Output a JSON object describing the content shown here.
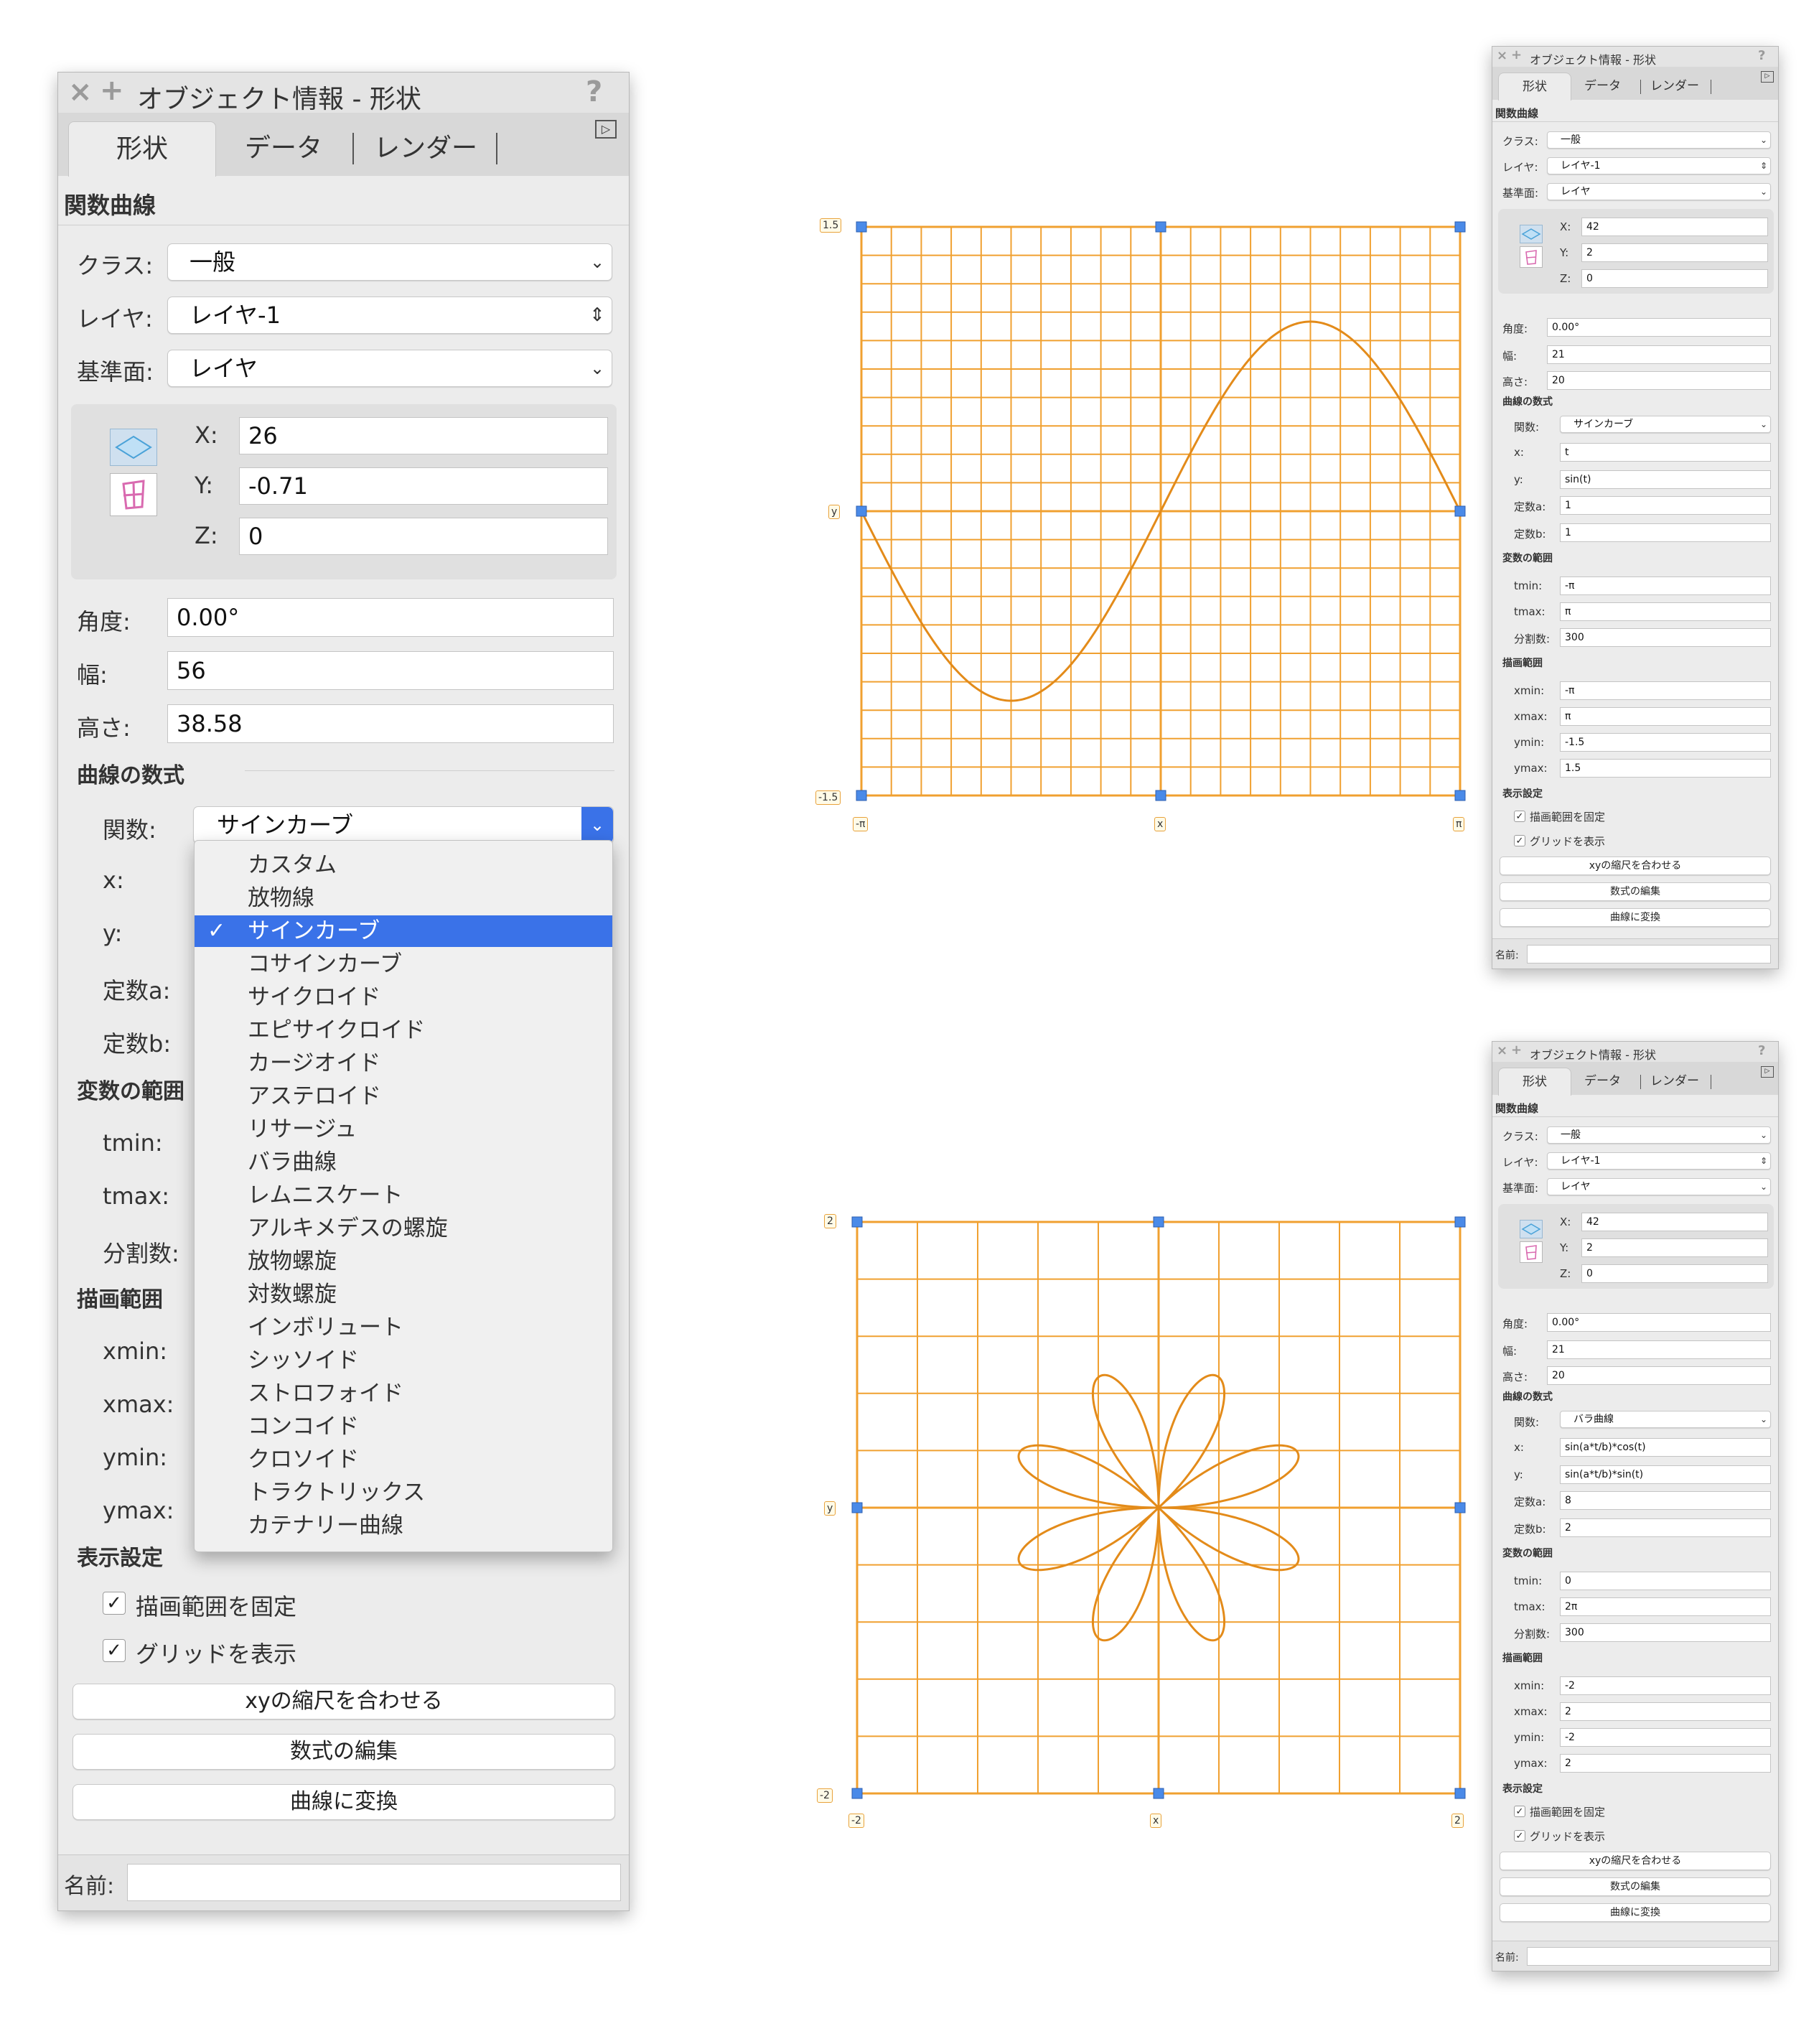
{
  "colors": {
    "grid": "#F0A030",
    "grid_major": "#E08A18",
    "curve": "#E38B1A",
    "handle": "#4A8AE8",
    "selected": "#3A72E8"
  },
  "big_palette": {
    "title": "オブジェクト情報 - 形状",
    "close_icon": "×",
    "add_icon": "+",
    "help_icon": "?",
    "tabs": [
      "形状",
      "データ",
      "レンダー"
    ],
    "section": "関数曲線",
    "class_label": "クラス:",
    "class_value": "一般",
    "layer_label": "レイヤ:",
    "layer_value": "レイヤ-1",
    "plane_label": "基準面:",
    "plane_value": "レイヤ",
    "x_label": "X:",
    "x_value": "26",
    "y_label": "Y:",
    "y_value": "-0.71",
    "z_label": "Z:",
    "z_value": "0",
    "angle_label": "角度:",
    "angle_value": "0.00°",
    "width_label": "幅:",
    "width_value": "56",
    "height_label": "高さ:",
    "height_value": "38.58",
    "formula_section": "曲線の数式",
    "func_label": "関数:",
    "func_value": "サインカーブ",
    "fx_label": "x:",
    "fy_label": "y:",
    "a_label": "定数a:",
    "b_label": "定数b:",
    "var_section": "変数の範囲",
    "tmin_label": "tmin:",
    "tmax_label": "tmax:",
    "div_label": "分割数:",
    "draw_section": "描画範囲",
    "xmin_label": "xmin:",
    "xmax_label": "xmax:",
    "ymin_label": "ymin:",
    "ymax_label": "ymax:",
    "display_section": "表示設定",
    "fix_range": "描画範囲を固定",
    "show_grid": "グリッドを表示",
    "btn_scale": "xyの縮尺を合わせる",
    "btn_edit": "数式の編集",
    "btn_convert": "曲線に変換",
    "name_label": "名前:"
  },
  "dropdown": {
    "items": [
      "カスタム",
      "放物線",
      "サインカーブ",
      "コサインカーブ",
      "サイクロイド",
      "エピサイクロイド",
      "カージオイド",
      "アステロイド",
      "リサージュ",
      "バラ曲線",
      "レムニスケート",
      "アルキメデスの螺旋",
      "放物螺旋",
      "対数螺旋",
      "インボリュート",
      "シッソイド",
      "ストロフォイド",
      "コンコイド",
      "クロソイド",
      "トラクトリックス",
      "カテナリー曲線"
    ],
    "selected_index": 2,
    "check": "✓"
  },
  "palette_top": {
    "title": "オブジェクト情報 - 形状",
    "tabs": [
      "形状",
      "データ",
      "レンダー"
    ],
    "section": "関数曲線",
    "class_label": "クラス:",
    "class_value": "一般",
    "layer_label": "レイヤ:",
    "layer_value": "レイヤ-1",
    "plane_label": "基準面:",
    "plane_value": "レイヤ",
    "x_label": "X:",
    "x_value": "42",
    "y_label": "Y:",
    "y_value": "2",
    "z_label": "Z:",
    "z_value": "0",
    "angle_label": "角度:",
    "angle_value": "0.00°",
    "width_label": "幅:",
    "width_value": "21",
    "height_label": "高さ:",
    "height_value": "20",
    "formula_section": "曲線の数式",
    "func_label": "関数:",
    "func_value": "サインカーブ",
    "fx_label": "x:",
    "fx_value": "t",
    "fy_label": "y:",
    "fy_value": "sin(t)",
    "a_label": "定数a:",
    "a_value": "1",
    "b_label": "定数b:",
    "b_value": "1",
    "var_section": "変数の範囲",
    "tmin_label": "tmin:",
    "tmin_value": "-π",
    "tmax_label": "tmax:",
    "tmax_value": "π",
    "div_label": "分割数:",
    "div_value": "300",
    "draw_section": "描画範囲",
    "xmin_label": "xmin:",
    "xmin_value": "-π",
    "xmax_label": "xmax:",
    "xmax_value": "π",
    "ymin_label": "ymin:",
    "ymin_value": "-1.5",
    "ymax_label": "ymax:",
    "ymax_value": "1.5",
    "display_section": "表示設定",
    "fix_range": "描画範囲を固定",
    "show_grid": "グリッドを表示",
    "btn_scale": "xyの縮尺を合わせる",
    "btn_edit": "数式の編集",
    "btn_convert": "曲線に変換",
    "name_label": "名前:"
  },
  "palette_bottom": {
    "title": "オブジェクト情報 - 形状",
    "tabs": [
      "形状",
      "データ",
      "レンダー"
    ],
    "section": "関数曲線",
    "class_label": "クラス:",
    "class_value": "一般",
    "layer_label": "レイヤ:",
    "layer_value": "レイヤ-1",
    "plane_label": "基準面:",
    "plane_value": "レイヤ",
    "x_label": "X:",
    "x_value": "42",
    "y_label": "Y:",
    "y_value": "2",
    "z_label": "Z:",
    "z_value": "0",
    "angle_label": "角度:",
    "angle_value": "0.00°",
    "width_label": "幅:",
    "width_value": "21",
    "height_label": "高さ:",
    "height_value": "20",
    "formula_section": "曲線の数式",
    "func_label": "関数:",
    "func_value": "バラ曲線",
    "fx_label": "x:",
    "fx_value": "sin(a*t/b)*cos(t)",
    "fy_label": "y:",
    "fy_value": "sin(a*t/b)*sin(t)",
    "a_label": "定数a:",
    "a_value": "8",
    "b_label": "定数b:",
    "b_value": "2",
    "var_section": "変数の範囲",
    "tmin_label": "tmin:",
    "tmin_value": "0",
    "tmax_label": "tmax:",
    "tmax_value": "2π",
    "div_label": "分割数:",
    "div_value": "300",
    "draw_section": "描画範囲",
    "xmin_label": "xmin:",
    "xmin_value": "-2",
    "xmax_label": "xmax:",
    "xmax_value": "2",
    "ymin_label": "ymin:",
    "ymin_value": "-2",
    "ymax_label": "ymax:",
    "ymax_value": "2",
    "display_section": "表示設定",
    "fix_range": "描画範囲を固定",
    "show_grid": "グリッドを表示",
    "btn_scale": "xyの縮尺を合わせる",
    "btn_edit": "数式の編集",
    "btn_convert": "曲線に変換",
    "name_label": "名前:"
  },
  "graph_sine": {
    "ymax_label": "1.5",
    "ymin_label": "-1.5",
    "xmin_label": "-π",
    "xmax_label": "π",
    "x_axis_label": "x",
    "y_axis_label": "y",
    "function": "sin(t)",
    "xlim": [
      -3.14159,
      3.14159
    ],
    "ylim": [
      -1.5,
      1.5
    ],
    "grid_cols": 20,
    "grid_rows": 20
  },
  "graph_rose": {
    "ymax_label": "2",
    "ymin_label": "-2",
    "xmin_label": "-2",
    "xmax_label": "2",
    "x_axis_label": "x",
    "y_axis_label": "y",
    "function": "sin(a*t/b)",
    "a": 8,
    "b": 2,
    "xlim": [
      -2,
      2
    ],
    "ylim": [
      -2,
      2
    ],
    "grid_cols": 10,
    "grid_rows": 10
  },
  "check_mark": "✓"
}
